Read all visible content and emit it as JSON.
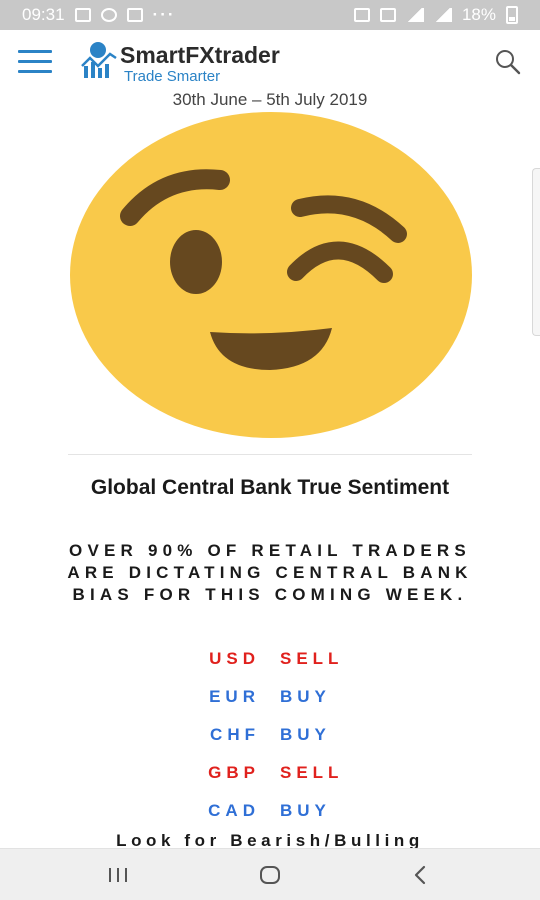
{
  "status_bar": {
    "time": "09:31",
    "battery": "18%",
    "dots": "···"
  },
  "header": {
    "brand": "SmartFXtrader",
    "tagline": "Trade Smarter"
  },
  "date_range": "30th June – 5th July 2019",
  "section": {
    "title": "Global Central Bank True Sentiment",
    "subtitle": "OVER 90% OF RETAIL TRADERS ARE DICTATING CENTRAL BANK BIAS FOR THIS COMING WEEK."
  },
  "currencies": [
    {
      "code": "USD",
      "action": "SELL",
      "color": "#e0211d"
    },
    {
      "code": "EUR",
      "action": "BUY",
      "color": "#2f6fd6"
    },
    {
      "code": "CHF",
      "action": "BUY",
      "color": "#2f6fd6"
    },
    {
      "code": "GBP",
      "action": "SELL",
      "color": "#e0211d"
    },
    {
      "code": "CAD",
      "action": "BUY",
      "color": "#2f6fd6"
    }
  ],
  "bottom_text": "Look for Bearish/Bulling",
  "colors": {
    "accent": "#2b83c6",
    "emoji_face": "#f9c94a",
    "emoji_features": "#66481f",
    "sell": "#e0211d",
    "buy": "#2f6fd6"
  },
  "icons": [
    "menu-icon",
    "logo-icon",
    "search-icon",
    "nav-recent-icon",
    "nav-home-icon",
    "nav-back-icon"
  ]
}
